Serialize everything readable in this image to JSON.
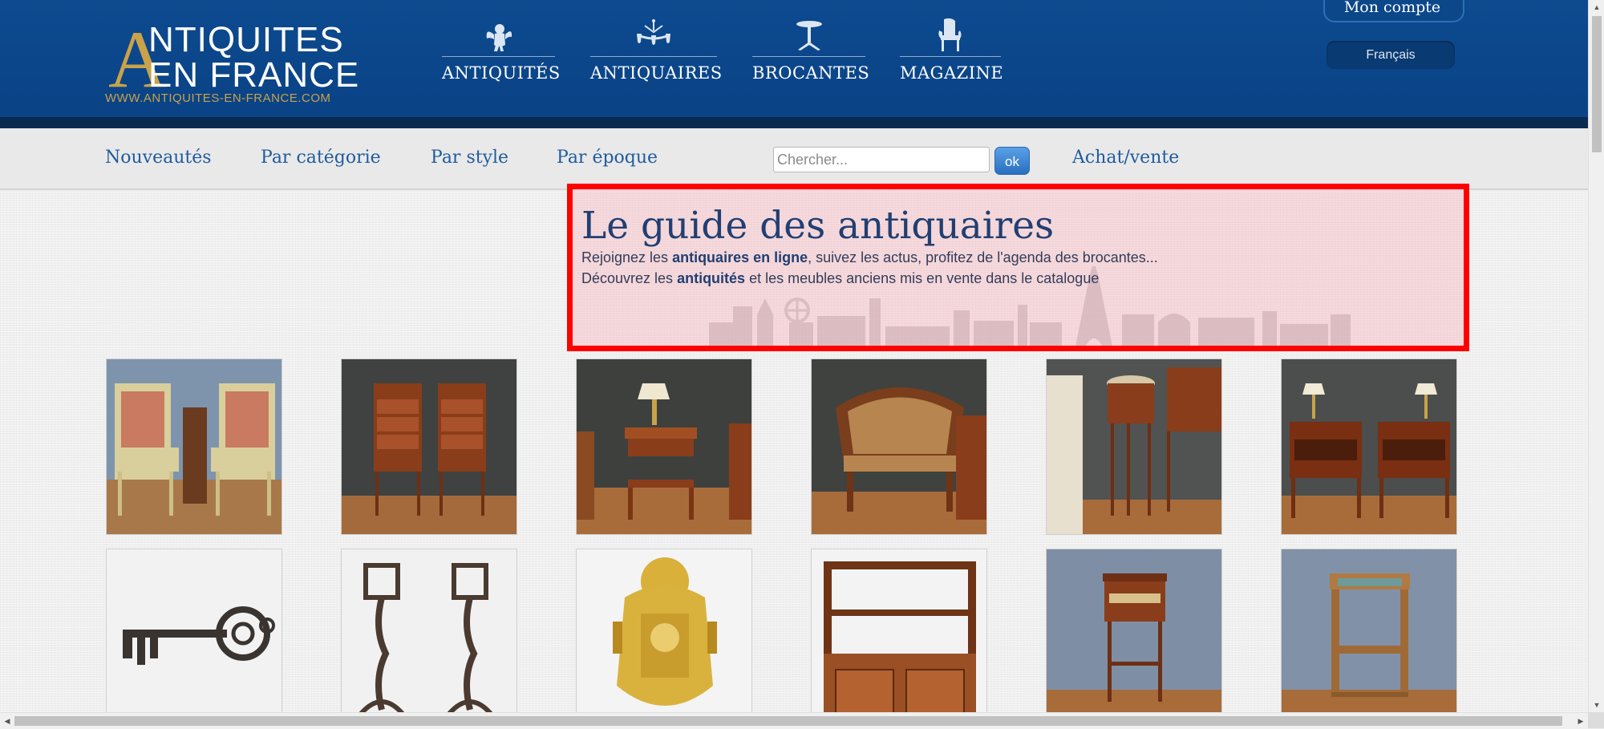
{
  "logo": {
    "initial": "A",
    "line1": "NTIQUITES",
    "line2": "EN FRANCE",
    "url": "WWW.ANTIQUITES-EN-FRANCE.COM"
  },
  "main_nav": [
    {
      "label": "ANTIQUITÉS",
      "icon": "cherub-icon"
    },
    {
      "label": "ANTIQUAIRES",
      "icon": "chandelier-icon"
    },
    {
      "label": "BROCANTES",
      "icon": "pedestal-table-icon"
    },
    {
      "label": "MAGAZINE",
      "icon": "armchair-icon"
    }
  ],
  "account": {
    "label": "Mon compte"
  },
  "language": {
    "label": "Français"
  },
  "sub_nav": [
    "Nouveautés",
    "Par catégorie",
    "Par style",
    "Par époque",
    "Achat/vente"
  ],
  "search": {
    "placeholder": "Chercher...",
    "button": "ok"
  },
  "hero": {
    "title": "Le guide des antiquaires",
    "line1": {
      "before": "Rejoignez les ",
      "bold": "antiquaires en ligne",
      "after": ", suivez les actus, profitez de l'agenda des brocantes..."
    },
    "line2": {
      "before": "Découvrez les ",
      "bold": "antiquités",
      "after": " et les meubles anciens mis en vente dans le catalogue"
    }
  },
  "products": [
    {
      "subject": "pair-of-painted-armchairs"
    },
    {
      "subject": "pair-of-bedside-tables"
    },
    {
      "subject": "side-table-with-lamp"
    },
    {
      "subject": "cane-corner-armchair"
    },
    {
      "subject": "round-gueridon-table"
    },
    {
      "subject": "pair-of-night-stands"
    },
    {
      "subject": "antique-iron-key"
    },
    {
      "subject": "pair-of-andirons"
    },
    {
      "subject": "gilt-bronze-wall-clock"
    },
    {
      "subject": "hanging-shelf-cabinet"
    },
    {
      "subject": "small-writing-table"
    },
    {
      "subject": "art-deco-side-table"
    }
  ],
  "colors": {
    "header_blue": "#0d4a8f",
    "gold": "#c9a24a",
    "link_blue": "#1f5b9e",
    "highlight_red": "#ff0000"
  }
}
